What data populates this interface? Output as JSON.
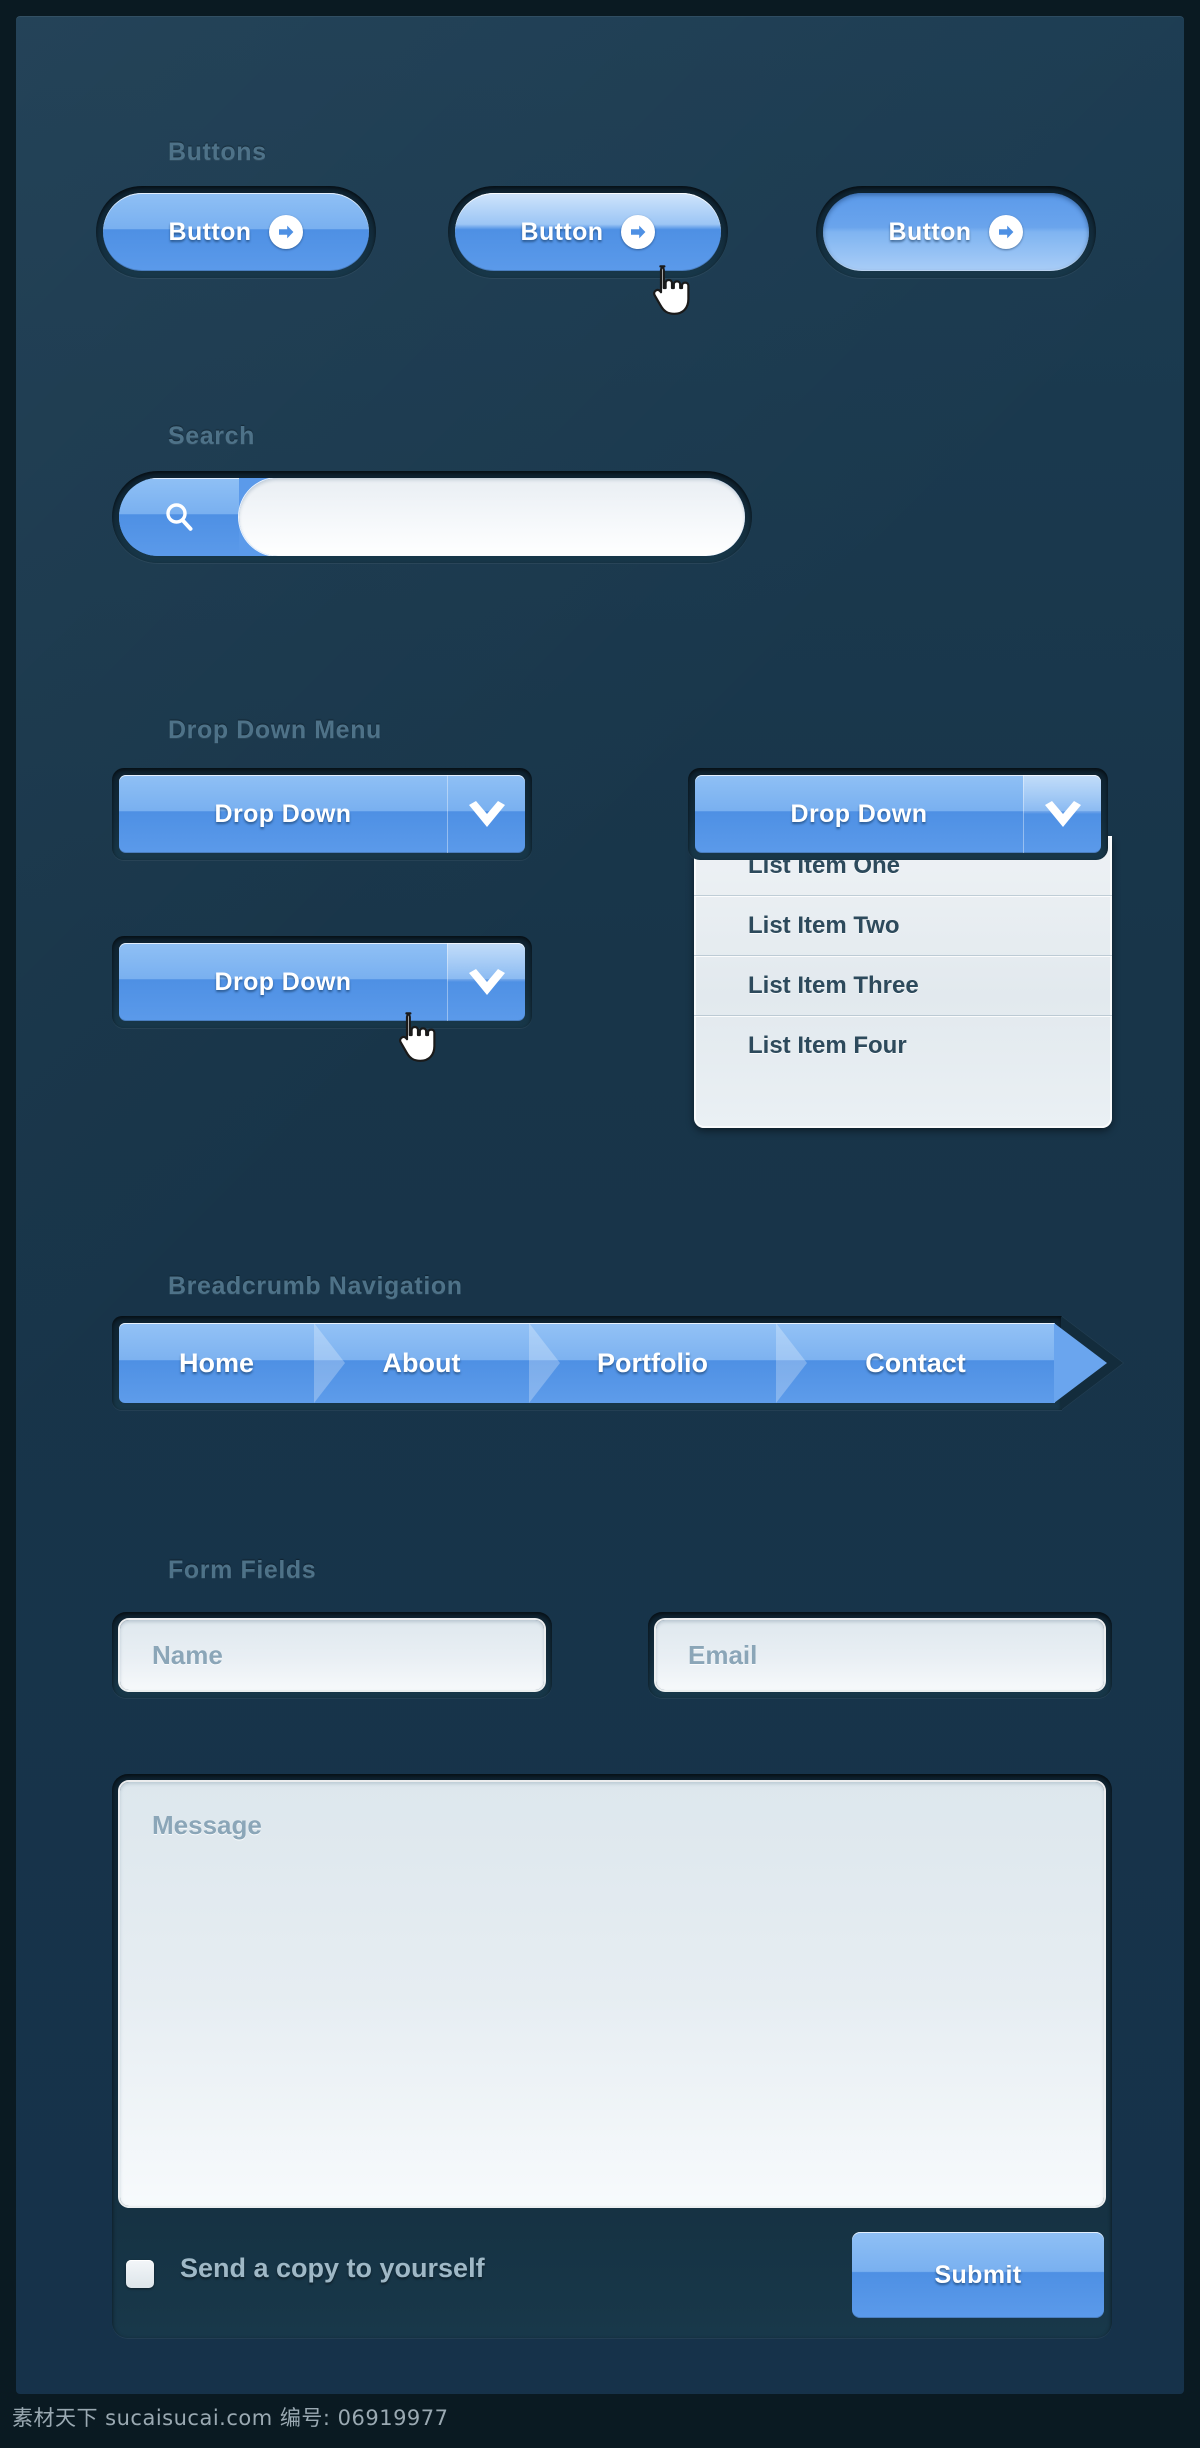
{
  "sections": {
    "buttons_label": "Buttons",
    "search_label": "Search",
    "dropdown_label": "Drop Down Menu",
    "breadcrumb_label": "Breadcrumb Navigation",
    "form_label": "Form Fields"
  },
  "buttons": [
    {
      "label": "Button",
      "state": "normal"
    },
    {
      "label": "Button",
      "state": "hover"
    },
    {
      "label": "Button",
      "state": "active"
    }
  ],
  "search": {
    "value": "",
    "placeholder": "",
    "icon": "search-icon"
  },
  "dropdowns": {
    "closed_normal": {
      "label": "Drop Down",
      "icon": "chevron-down-icon"
    },
    "closed_hover": {
      "label": "Drop Down",
      "icon": "chevron-down-icon"
    },
    "open": {
      "label": "Drop Down",
      "icon": "chevron-down-icon",
      "items": [
        "List Item One",
        "List Item Two",
        "List Item Three",
        "List Item Four"
      ]
    }
  },
  "breadcrumb": {
    "items": [
      "Home",
      "About",
      "Portfolio",
      "Contact"
    ]
  },
  "form": {
    "name_placeholder": "Name",
    "email_placeholder": "Email",
    "message_placeholder": "Message",
    "name_value": "",
    "email_value": "",
    "message_value": "",
    "checkbox_label": "Send a copy to yourself",
    "checkbox_checked": false,
    "submit_label": "Submit"
  },
  "watermark": "素材天下 sucaisucai.com  编号: 06919977",
  "colors": {
    "background": "#16324a",
    "frame": "#0a1a22",
    "accent_blue": "#5b9aea",
    "accent_light": "#8fc0f5",
    "label_text": "#4e7288",
    "field_text": "#8ba6b8",
    "list_text": "#2d4a5c"
  }
}
